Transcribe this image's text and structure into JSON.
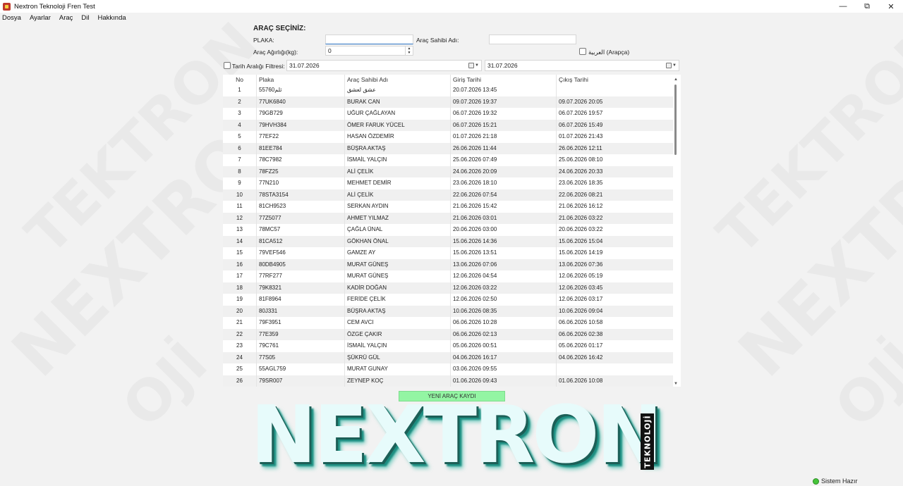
{
  "window": {
    "title": "Nextron Teknoloji Fren Test",
    "minimize": "—",
    "maximize": "⧉",
    "close": "✕"
  },
  "menu": [
    "Dosya",
    "Ayarlar",
    "Araç",
    "Dil",
    "Hakkında"
  ],
  "watermark": {
    "brand": "NEXTRON",
    "brand_top": "TEKTRON",
    "suffix": "OJİ"
  },
  "form": {
    "title": "ARAÇ SEÇİNİZ:",
    "plate_label": "PLAKA:",
    "plate_value": "",
    "owner_label": "Araç Sahibi Adı:",
    "owner_value": "",
    "weight_label": "Araç Ağırlığı(kg):",
    "weight_value": "0",
    "arabic_label": "العربية (Arapça)",
    "date_filter_label": "Tarih Aralığı Filtresi:",
    "date_from": "31.07.2026",
    "date_to": "31.07.2026"
  },
  "table": {
    "headers": [
      "No",
      "Plaka",
      "Araç Sahibi Adı",
      "Giriş Tarihi",
      "Çıkış Tarihi"
    ],
    "rows": [
      [
        "1",
        "55ثلم760",
        "عشق لعشق",
        "20.07.2026 13:45",
        ""
      ],
      [
        "2",
        "77UK6840",
        "BURAK CAN",
        "09.07.2026 19:37",
        "09.07.2026 20:05"
      ],
      [
        "3",
        "79GB729",
        "UĞUR ÇAĞLAYAN",
        "06.07.2026 19:32",
        "06.07.2026 19:57"
      ],
      [
        "4",
        "79HVH384",
        "ÖMER FARUK YÜCEL",
        "06.07.2026 15:21",
        "06.07.2026 15:49"
      ],
      [
        "5",
        "77EF22",
        "HASAN ÖZDEMİR",
        "01.07.2026 21:18",
        "01.07.2026 21:43"
      ],
      [
        "6",
        "81EE784",
        "BÜŞRA AKTAŞ",
        "26.06.2026 11:44",
        "26.06.2026 12:11"
      ],
      [
        "7",
        "78C7982",
        "İSMAİL YALÇIN",
        "25.06.2026 07:49",
        "25.06.2026 08:10"
      ],
      [
        "8",
        "78FZ25",
        "ALİ ÇELİK",
        "24.06.2026 20:09",
        "24.06.2026 20:33"
      ],
      [
        "9",
        "77N210",
        "MEHMET DEMİR",
        "23.06.2026 18:10",
        "23.06.2026 18:35"
      ],
      [
        "10",
        "78STA3154",
        "ALİ ÇELİK",
        "22.06.2026 07:54",
        "22.06.2026 08:21"
      ],
      [
        "11",
        "81CH9523",
        "SERKAN AYDIN",
        "21.06.2026 15:42",
        "21.06.2026 16:12"
      ],
      [
        "12",
        "77Z5077",
        "AHMET YILMAZ",
        "21.06.2026 03:01",
        "21.06.2026 03:22"
      ],
      [
        "13",
        "78MC57",
        "ÇAĞLA ÜNAL",
        "20.06.2026 03:00",
        "20.06.2026 03:22"
      ],
      [
        "14",
        "81CA512",
        "GÖKHAN ÖNAL",
        "15.06.2026 14:36",
        "15.06.2026 15:04"
      ],
      [
        "15",
        "79VEF546",
        "GAMZE AY",
        "15.06.2026 13:51",
        "15.06.2026 14:19"
      ],
      [
        "16",
        "80DB4905",
        "MURAT GÜNEŞ",
        "13.06.2026 07:06",
        "13.06.2026 07:36"
      ],
      [
        "17",
        "77RF277",
        "MURAT GÜNEŞ",
        "12.06.2026 04:54",
        "12.06.2026 05:19"
      ],
      [
        "18",
        "79K8321",
        "KADİR DOĞAN",
        "12.06.2026 03:22",
        "12.06.2026 03:45"
      ],
      [
        "19",
        "81F8964",
        "FERİDE ÇELİK",
        "12.06.2026 02:50",
        "12.06.2026 03:17"
      ],
      [
        "20",
        "80J331",
        "BÜŞRA AKTAŞ",
        "10.06.2026 08:35",
        "10.06.2026 09:04"
      ],
      [
        "21",
        "79F3951",
        "CEM AVCI",
        "06.06.2026 10:28",
        "06.06.2026 10:58"
      ],
      [
        "22",
        "77E359",
        "ÖZGE ÇAKIR",
        "06.06.2026 02:13",
        "06.06.2026 02:38"
      ],
      [
        "23",
        "79C761",
        "İSMAİL YALÇIN",
        "05.06.2026 00:51",
        "05.06.2026 01:17"
      ],
      [
        "24",
        "77S05",
        "ŞÜKRÜ GÜL",
        "04.06.2026 16:17",
        "04.06.2026 16:42"
      ],
      [
        "25",
        "55AGL759",
        "MURAT GUNAY",
        "03.06.2026 09:55",
        ""
      ],
      [
        "26",
        "79SR007",
        "ZEYNEP KOÇ",
        "01.06.2026 09:43",
        "01.06.2026 10:08"
      ]
    ]
  },
  "new_record_button": "YENİ ARAÇ KAYDI",
  "logo": {
    "main": "NEXTRON",
    "sub": "TEKNOLOJİ"
  },
  "status": {
    "text": "Sistem Hazır",
    "color": "#46c43a"
  }
}
